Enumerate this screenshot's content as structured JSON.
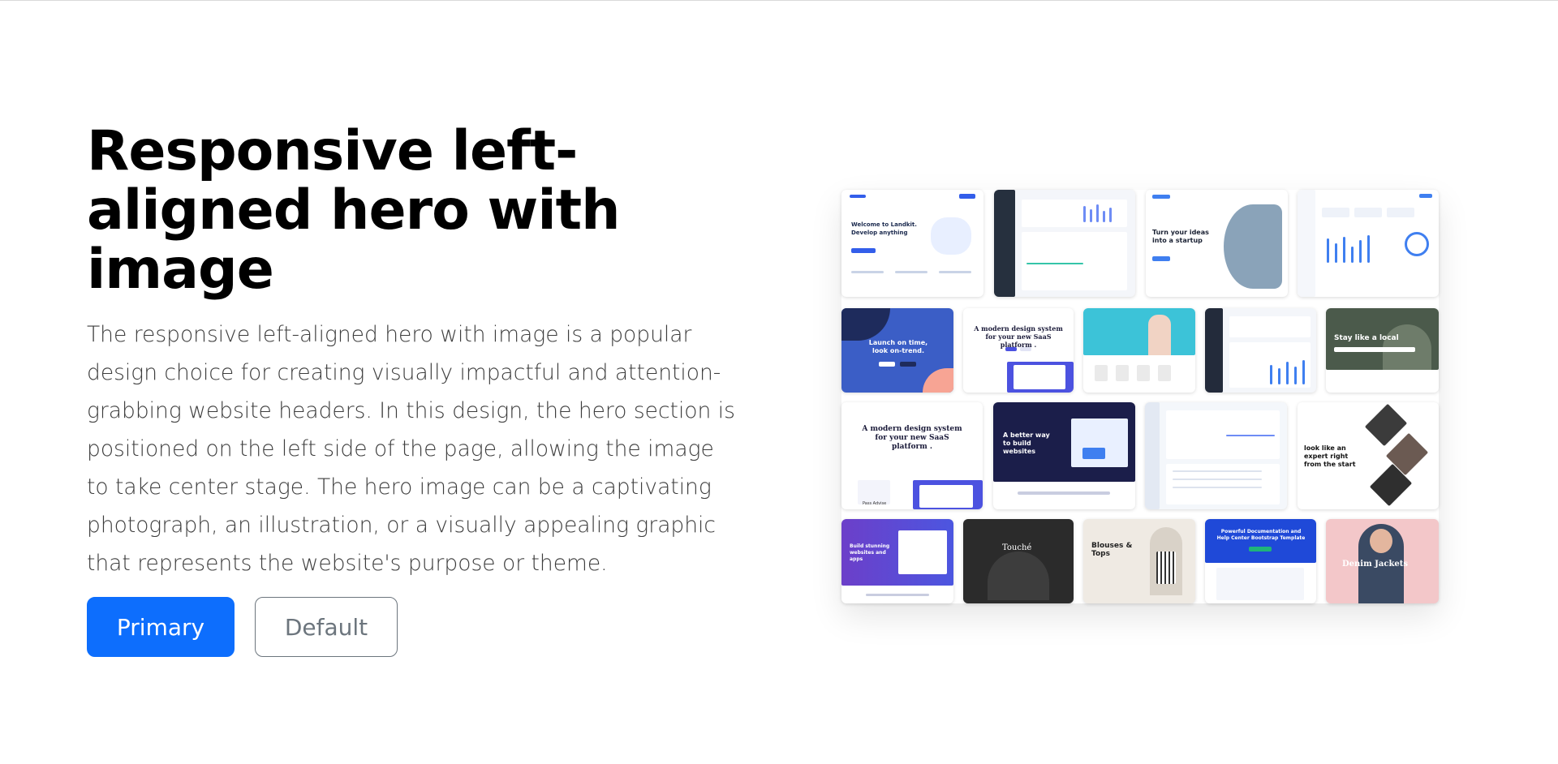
{
  "hero": {
    "title": "Responsive left-aligned hero with image",
    "lead": "The responsive left-aligned hero with image is a popular design choice for creating visually impactful and attention-grabbing website headers. In this design, the hero section is positioned on the left side of the page, allowing the image to take center stage. The hero image can be a captivating photograph, an illustration, or a visually appealing graphic that represents the website's purpose or theme."
  },
  "buttons": {
    "primary_label": "Primary",
    "default_label": "Default"
  },
  "mosaic": {
    "captions": {
      "welcome": "Welcome to Landkit. Develop anything",
      "ideas": "Turn your ideas into a startup",
      "launch": "Launch on time, look on-trend.",
      "saas1": "A modern design system for your new SaaS platform .",
      "saas2": "A modern design system for your new SaaS platform .",
      "better": "A better way to build websites",
      "local": "Stay like a local",
      "expert": "look like an expert right from the start",
      "touche": "Touché",
      "blouses": "Blouses & Tops",
      "docs": "Powerful Documentation and Help Center Bootstrap Template",
      "denim": "Denim Jackets",
      "build": "Build stunning websites and apps",
      "pass": "Pass Advise"
    }
  },
  "colors": {
    "primary": "#0d6efd",
    "default_border": "#6c757d"
  }
}
